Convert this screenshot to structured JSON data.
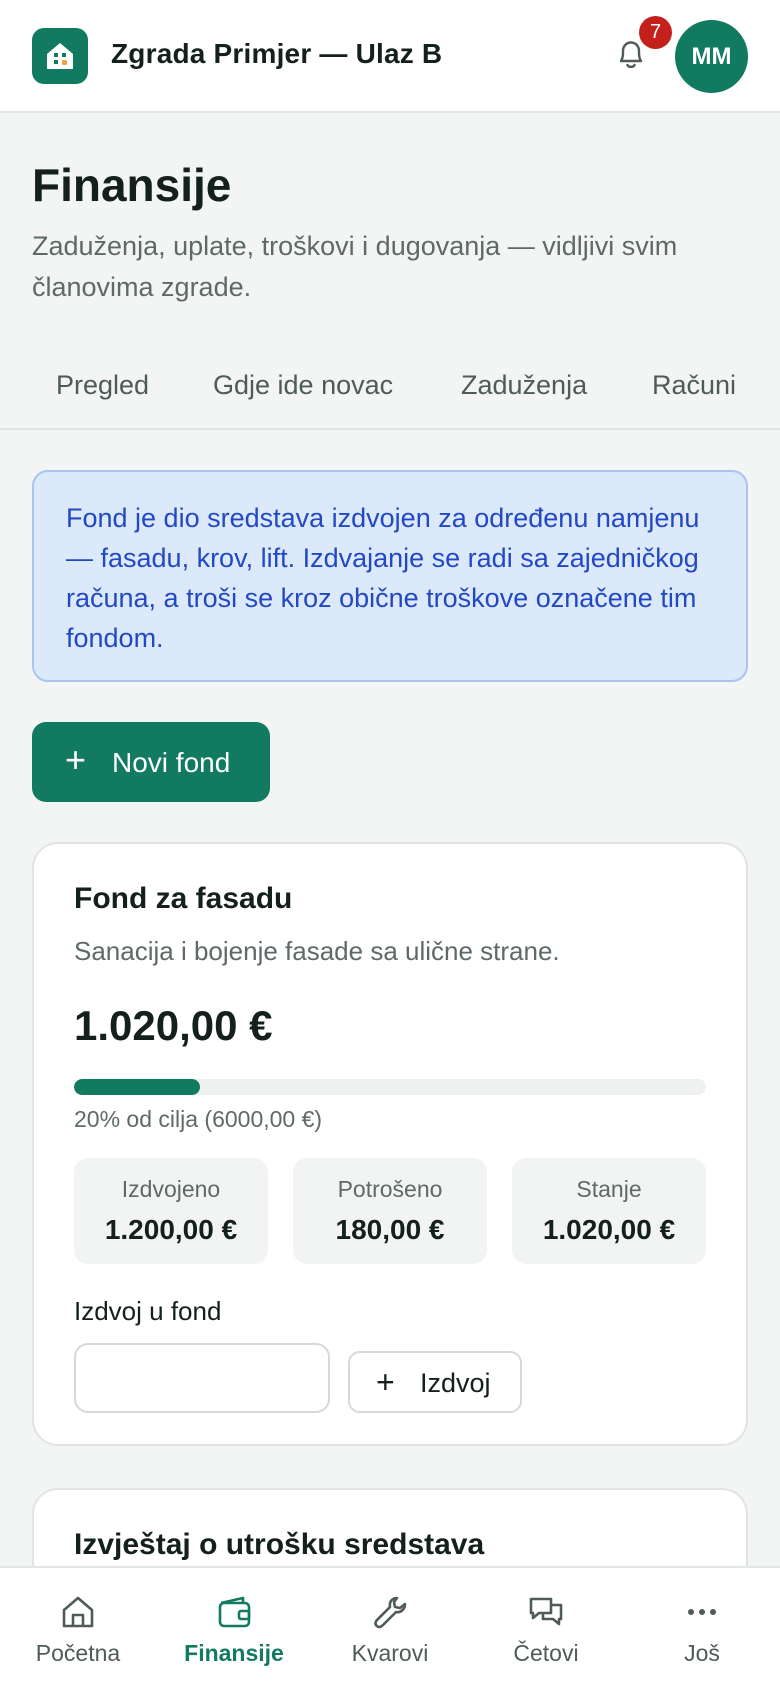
{
  "header": {
    "title": "Zgrada Primjer — Ulaz B",
    "notification_count": "7",
    "avatar_initials": "MM"
  },
  "page": {
    "title": "Finansije",
    "subtitle": "Zaduženja, uplate, troškovi i dugovanja — vidljivi svim članovima zgrade."
  },
  "tabs": [
    {
      "label": "Pregled"
    },
    {
      "label": "Gdje ide novac"
    },
    {
      "label": "Zaduženja"
    },
    {
      "label": "Računi"
    }
  ],
  "info_text": "Fond je dio sredstava izdvojen za određenu namjenu — fasadu, krov, lift. Izdvajanje se radi sa zajedničkog računa, a troši se kroz obične troškove označene tim fondom.",
  "new_fund_button": "Novi fond",
  "fund": {
    "title": "Fond za fasadu",
    "description": "Sanacija i bojenje fasade sa ulične strane.",
    "balance": "1.020,00 €",
    "progress_percent": 20,
    "progress_text": "20% od cilja (6000,00 €)",
    "stats": [
      {
        "label": "Izdvojeno",
        "value": "1.200,00 €"
      },
      {
        "label": "Potrošeno",
        "value": "180,00 €"
      },
      {
        "label": "Stanje",
        "value": "1.020,00 €"
      }
    ],
    "allocate_label": "Izdvoj u fond",
    "allocate_input_value": "",
    "allocate_button": "Izdvoj"
  },
  "report_card": {
    "title": "Izvještaj o utrošku sredstava"
  },
  "bottom_nav": [
    {
      "label": "Početna",
      "icon": "home-icon"
    },
    {
      "label": "Finansije",
      "icon": "wallet-icon",
      "active": true
    },
    {
      "label": "Kvarovi",
      "icon": "wrench-icon"
    },
    {
      "label": "Četovi",
      "icon": "chat-icon"
    },
    {
      "label": "Još",
      "icon": "more-icon"
    }
  ],
  "colors": {
    "brand": "#137a62",
    "badge": "#c5211c",
    "info_bg": "#dce9fb",
    "info_text": "#2348c4"
  }
}
